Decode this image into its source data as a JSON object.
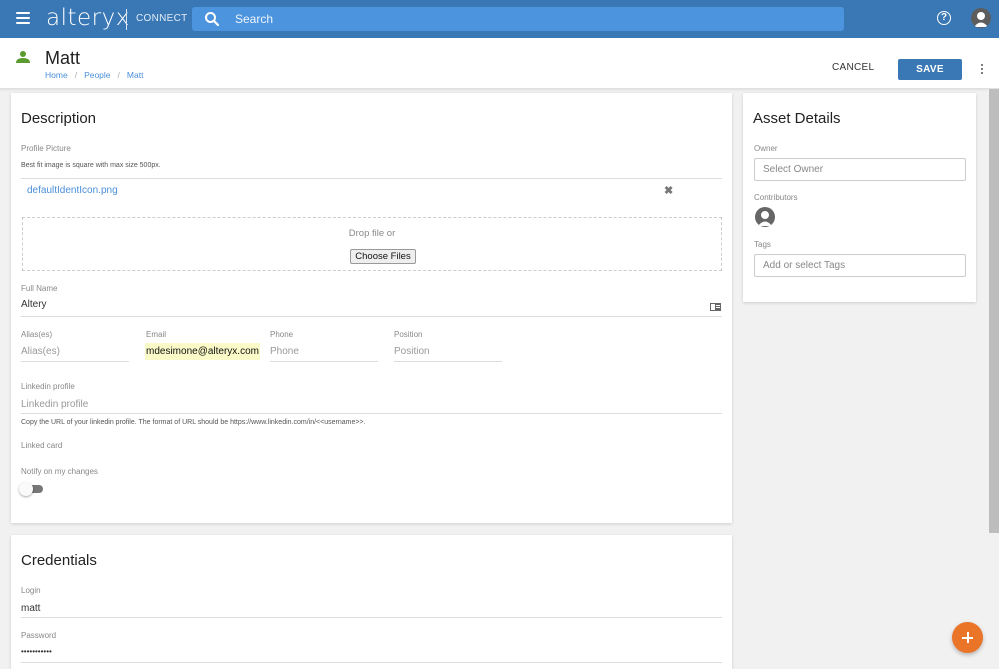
{
  "topbar": {
    "logo": "alteryx",
    "product": "CONNECT",
    "search_placeholder": "Search"
  },
  "header": {
    "title": "Matt",
    "breadcrumb": [
      "Home",
      "People",
      "Matt"
    ],
    "cancel_label": "CANCEL",
    "save_label": "SAVE"
  },
  "description": {
    "title": "Description",
    "profile_picture_label": "Profile Picture",
    "profile_picture_help": "Best fit image is square with max size 500px.",
    "file_name": "defaultIdentIcon.png",
    "drop_text": "Drop file or",
    "choose_files_label": "Choose Files",
    "full_name_label": "Full Name",
    "full_name_value": "Altery",
    "aliases_label": "Alias(es)",
    "aliases_placeholder": "Alias(es)",
    "email_label": "Email",
    "email_value": "mdesimone@alteryx.com",
    "phone_label": "Phone",
    "phone_placeholder": "Phone",
    "position_label": "Position",
    "position_placeholder": "Position",
    "linkedin_label": "Linkedin profile",
    "linkedin_placeholder": "Linkedin profile",
    "linkedin_help": "Copy the URL of your linkedin profile. The format of URL should be https://www.linkedin.com/in/<<username>>.",
    "linked_card_label": "Linked card",
    "notify_label": "Notify on my changes",
    "notify_enabled": false
  },
  "asset_details": {
    "title": "Asset Details",
    "owner_label": "Owner",
    "owner_placeholder": "Select Owner",
    "contributors_label": "Contributors",
    "tags_label": "Tags",
    "tags_placeholder": "Add or select Tags"
  },
  "credentials": {
    "title": "Credentials",
    "login_label": "Login",
    "login_value": "matt",
    "password_label": "Password",
    "password_value": "•••••••••••"
  },
  "colors": {
    "brand": "#3a78b5",
    "search_bg": "#4c95de",
    "fab": "#ea7428",
    "person_icon": "#5a9a2e",
    "link": "#4a8fd9",
    "autofill": "#fafac8"
  }
}
